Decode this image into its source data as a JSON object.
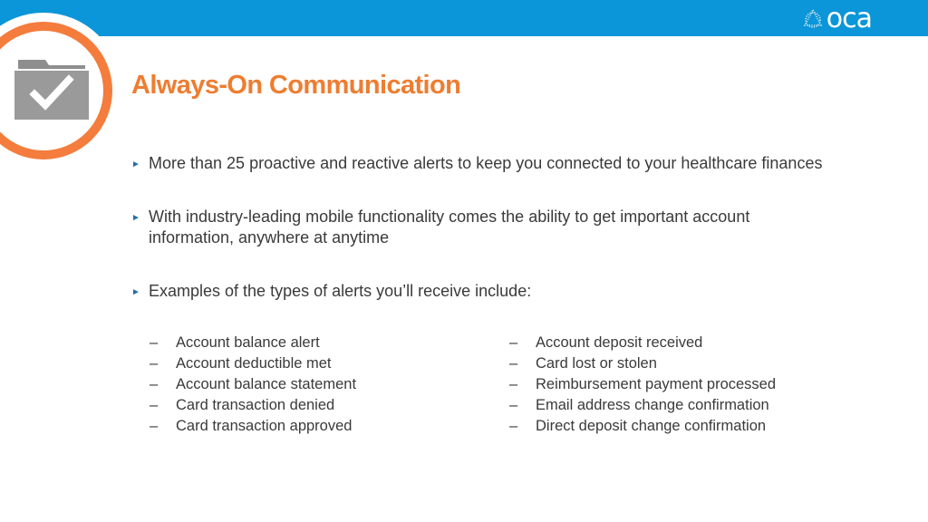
{
  "header": {
    "brand": "oca",
    "brand_color": "#0a96d8"
  },
  "slide": {
    "title": "Always-On Communication",
    "title_color": "#ee7d31",
    "accent_ring_color": "#f47c3c",
    "icon": "folder-check-icon",
    "bullet_marker": "►",
    "bullets": [
      "More than 25 proactive and reactive alerts to keep you connected to your healthcare finances",
      "With industry-leading mobile functionality comes the ability to get important account information, anywhere at anytime",
      "Examples of the types of alerts you’ll receive include:"
    ],
    "dash": "–",
    "alerts_left": [
      "Account balance alert",
      "Account deductible met",
      "Account balance statement",
      "Card transaction denied",
      "Card transaction approved"
    ],
    "alerts_right": [
      "Account deposit received",
      "Card lost or stolen",
      "Reimbursement payment processed",
      "Email address change confirmation",
      "Direct deposit change confirmation"
    ]
  }
}
